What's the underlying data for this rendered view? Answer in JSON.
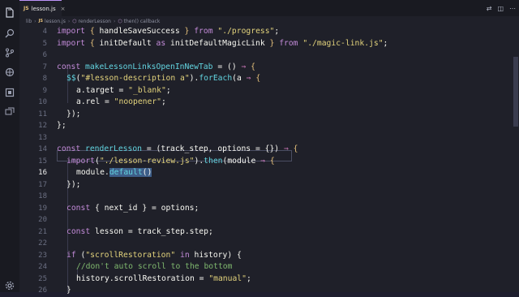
{
  "tab": {
    "ext": "JS",
    "name": "lesson.js",
    "close": "×"
  },
  "tab_actions": [
    "⇄",
    "◫",
    "⋯"
  ],
  "breadcrumb": {
    "folder": "lib",
    "file": "lesson.js",
    "fn1": "renderLesson",
    "fn2": "then() callback"
  },
  "code": {
    "l4": "import { handleSaveSuccess } from \"./progress\";",
    "l5a": "import { initDefault as initDefaultMagicLink } from ",
    "l5b": "\"./magic-link.js\"",
    "l7a": "const ",
    "l7b": "makeLessonLinksOpenInNewTab",
    "l7c": " = () ",
    "l7d": "⇒",
    "l7e": " {",
    "l8a": "$$",
    "l8b": "(",
    "l8c": "\"#lesson-description a\"",
    "l8d": ").",
    "l8e": "forEach",
    "l8f": "(a ",
    "l8g": "⇒",
    "l8h": " {",
    "l9a": "a.target = ",
    "l9b": "\"_blank\"",
    "l9c": ";",
    "l10a": "a.rel = ",
    "l10b": "\"noopener\"",
    "l10c": ";",
    "l11": "});",
    "l12": "};",
    "l14a": "const ",
    "l14b": "renderLesson",
    "l14c": " = (track_step, options = {}) ",
    "l14d": "⇒",
    "l14e": " {",
    "l15a": "import",
    "l15b": "(",
    "l15c": "\"./lesson-review.js\"",
    "l15d": ").",
    "l15e": "then",
    "l15f": "(module ",
    "l15g": "⇒",
    "l15h": " {",
    "l16a": "module.",
    "l16b": "default",
    "l16c": "()",
    "l17": "});",
    "l19a": "const ",
    "l19b": "{ next_id } = options;",
    "l21a": "const ",
    "l21b": "lesson = track_step.step;",
    "l23a": "if ",
    "l23b": "(",
    "l23c": "\"scrollRestoration\"",
    "l23d": " in ",
    "l23e": "history) {",
    "l24": "//don't auto scroll to the bottom",
    "l25a": "history.scrollRestoration = ",
    "l25b": "\"manual\"",
    "l25c": ";",
    "l26": "}"
  },
  "line_numbers": [
    "4",
    "5",
    "6",
    "7",
    "8",
    "9",
    "10",
    "11",
    "12",
    "13",
    "14",
    "15",
    "16",
    "17",
    "18",
    "19",
    "20",
    "21",
    "22",
    "23",
    "24",
    "25",
    "26"
  ],
  "colors": {
    "keyword": "#c38bd9",
    "string": "#e3d37c",
    "function": "#62d4e0",
    "comment": "#7fb86e",
    "selection": "#3e5f8a"
  }
}
